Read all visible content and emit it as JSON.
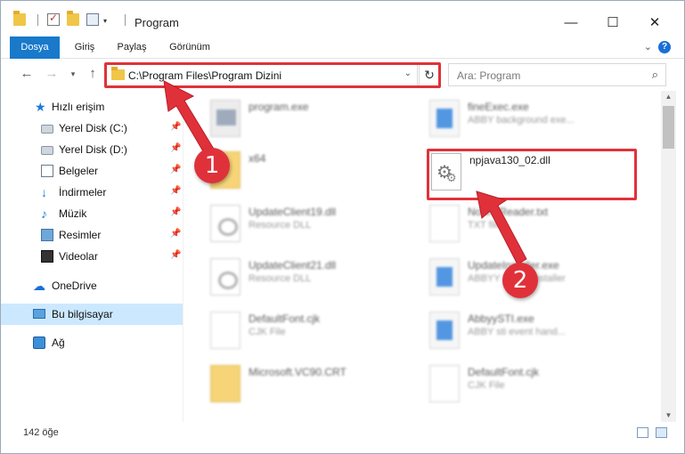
{
  "window": {
    "title": "Program",
    "minimize": "—",
    "maximize": "☐",
    "close": "✕"
  },
  "ribbon": {
    "tabs": [
      "Dosya",
      "Giriş",
      "Paylaş",
      "Görünüm"
    ],
    "help": "?"
  },
  "address": {
    "path": "C:\\Program Files\\Program Dizini",
    "search_placeholder": "Ara: Program"
  },
  "sidebar": {
    "items": [
      {
        "label": "Hızlı erişim",
        "icon": "star-icon"
      },
      {
        "label": "Yerel Disk (C:)",
        "icon": "drive-icon",
        "pinned": true
      },
      {
        "label": "Yerel Disk (D:)",
        "icon": "drive-icon",
        "pinned": true
      },
      {
        "label": "Belgeler",
        "icon": "documents-icon",
        "pinned": true
      },
      {
        "label": "İndirmeler",
        "icon": "download-icon",
        "pinned": true
      },
      {
        "label": "Müzik",
        "icon": "music-icon",
        "pinned": true
      },
      {
        "label": "Resimler",
        "icon": "pictures-icon",
        "pinned": true
      },
      {
        "label": "Videolar",
        "icon": "videos-icon",
        "pinned": true
      },
      {
        "label": "OneDrive",
        "icon": "cloud-icon"
      },
      {
        "label": "Bu bilgisayar",
        "icon": "computer-icon",
        "selected": true
      },
      {
        "label": "Ağ",
        "icon": "network-icon"
      }
    ]
  },
  "files": [
    {
      "name": "program.exe",
      "desc": "",
      "icon": "exe-icon"
    },
    {
      "name": "fineExec.exe",
      "desc": "ABBY background exe...",
      "icon": "app-icon"
    },
    {
      "name": "x64",
      "desc": "",
      "icon": "folder-icon"
    },
    {
      "name": "npjava130_02.dll",
      "desc": "",
      "icon": "dll-icon"
    },
    {
      "name": "UpdateClient19.dll",
      "desc": "Resource DLL",
      "icon": "dll-icon"
    },
    {
      "name": "NonneReader.txt",
      "desc": "TXT file",
      "icon": "text-file-icon"
    },
    {
      "name": "UpdateClient21.dll",
      "desc": "Resource DLL",
      "icon": "dll-icon"
    },
    {
      "name": "UpdateInstaller.exe",
      "desc": "ABBYY Demo installer",
      "icon": "app-icon"
    },
    {
      "name": "DefaultFont.cjk",
      "desc": "CJK File",
      "icon": "text-file-icon"
    },
    {
      "name": "AbbyySTI.exe",
      "desc": "ABBY sti event hand...",
      "icon": "app-icon"
    },
    {
      "name": "Microsoft.VC90.CRT",
      "desc": "",
      "icon": "folder-icon"
    },
    {
      "name": "DefaultFont.cjk",
      "desc": "CJK File",
      "icon": "text-file-icon"
    }
  ],
  "status": {
    "item_count": "142 öğe"
  },
  "annotations": {
    "step1": "1",
    "step2": "2",
    "color": "#e0313a"
  }
}
